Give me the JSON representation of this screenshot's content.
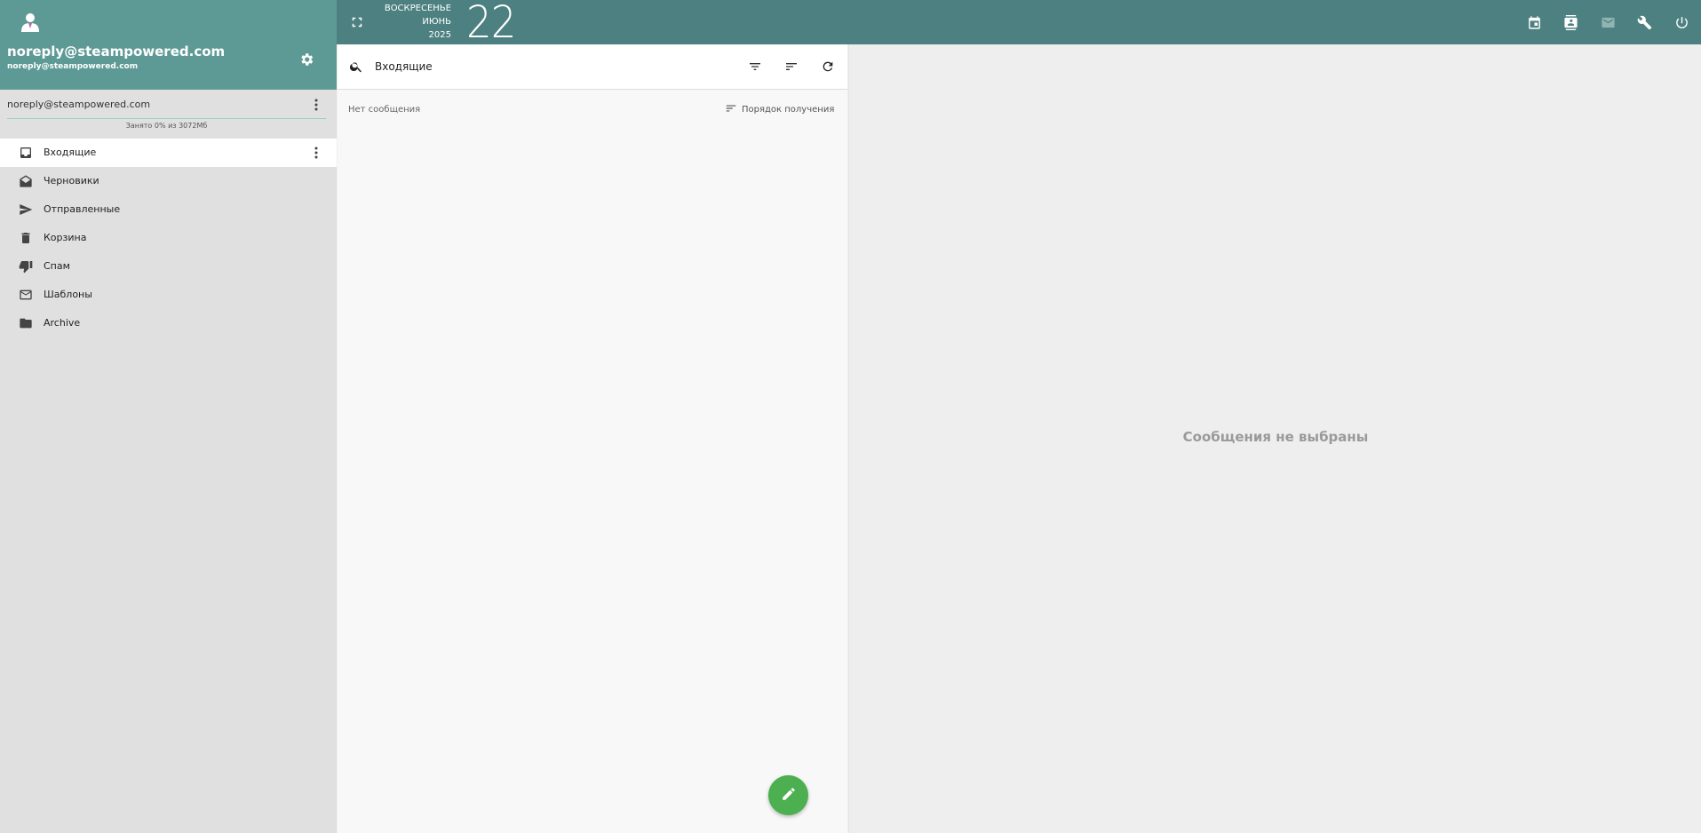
{
  "user": {
    "name": "noreply@steampowered.com",
    "email": "noreply@steampowered.com"
  },
  "account": {
    "label": "noreply@steampowered.com",
    "quota_text": "Занято 0% из 3072Мб",
    "quota_percent": 0
  },
  "folders": [
    {
      "label": "Входящие",
      "icon": "inbox-icon",
      "active": true
    },
    {
      "label": "Черновики",
      "icon": "drafts-icon"
    },
    {
      "label": "Отправленные",
      "icon": "send-icon"
    },
    {
      "label": "Корзина",
      "icon": "trash-icon"
    },
    {
      "label": "Спам",
      "icon": "thumb-down-icon"
    },
    {
      "label": "Шаблоны",
      "icon": "mail-icon"
    },
    {
      "label": "Archive",
      "icon": "folder-icon"
    }
  ],
  "date": {
    "weekday": "ВОСКРЕСЕНЬЕ",
    "month": "ИЮНЬ",
    "year": "2025",
    "day": "22"
  },
  "search": {
    "value": "Входящие"
  },
  "list": {
    "empty_text": "Нет сообщения",
    "sort_label": "Порядок получения"
  },
  "preview": {
    "empty_text": "Сообщения не выбраны"
  },
  "colors": {
    "header": "#5e9a95",
    "topbar": "#4d8080",
    "compose": "#4caf50"
  }
}
